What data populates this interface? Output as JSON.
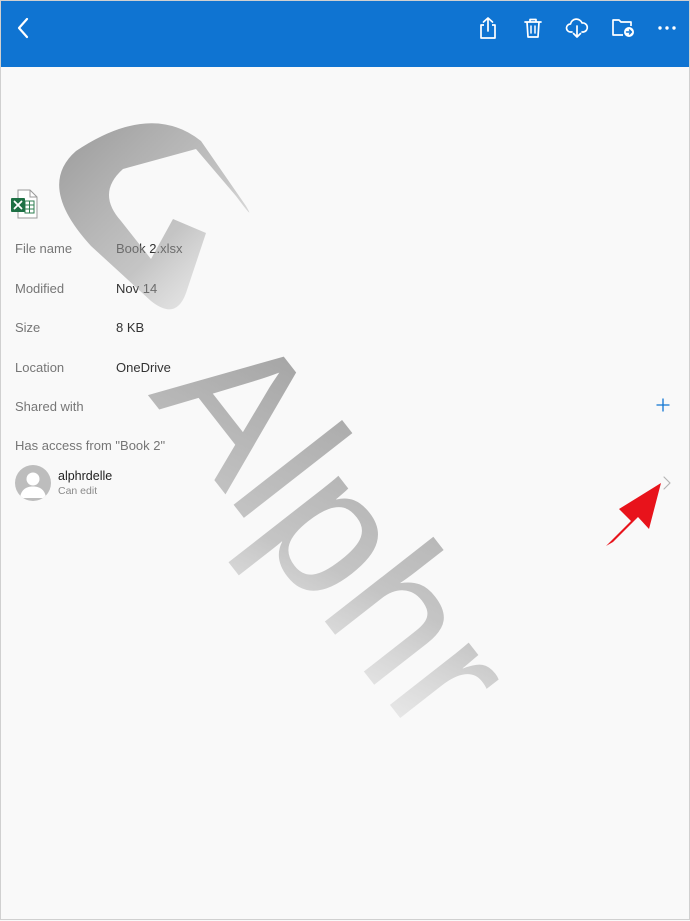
{
  "toolbar": {
    "back": "back-arrow-icon",
    "actions": [
      "share-icon",
      "trash-icon",
      "cloud-download-icon",
      "move-folder-icon",
      "more-icon"
    ],
    "color": "#0f74d2"
  },
  "file": {
    "icon": "excel-file-icon",
    "name_label": "File name",
    "name_value": "Book 2.xlsx",
    "modified_label": "Modified",
    "modified_value": "Nov 14",
    "size_label": "Size",
    "size_value": "8 KB",
    "location_label": "Location",
    "location_value": "OneDrive"
  },
  "sharing": {
    "shared_with_label": "Shared with",
    "access_label": "Has access from \"Book 2\"",
    "person": {
      "name": "alphrdelle",
      "role": "Can edit"
    }
  },
  "watermark": {
    "text": "Alphr"
  },
  "annotation_color": "#e8131b"
}
